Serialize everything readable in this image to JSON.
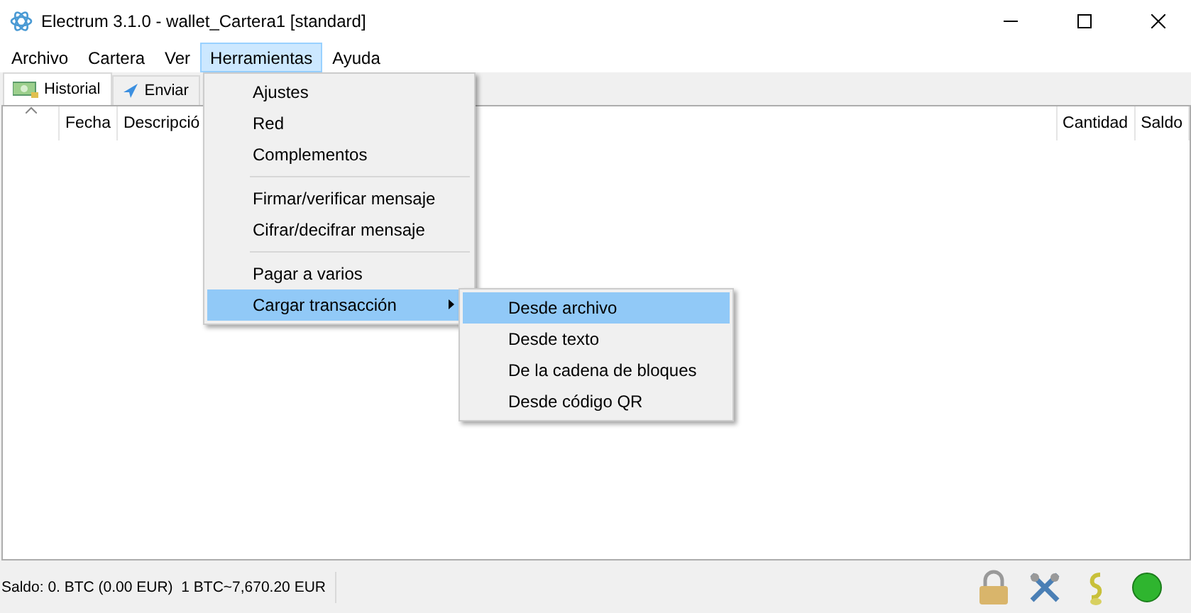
{
  "window": {
    "title": "Electrum 3.1.0  -  wallet_Cartera1  [standard]"
  },
  "menu_bar": [
    {
      "label": "Archivo",
      "selected": false
    },
    {
      "label": "Cartera",
      "selected": false
    },
    {
      "label": "Ver",
      "selected": false
    },
    {
      "label": "Herramientas",
      "selected": true
    },
    {
      "label": "Ayuda",
      "selected": false
    }
  ],
  "tabs": [
    {
      "label": "Historial",
      "selected": true
    },
    {
      "label": "Enviar",
      "selected": false
    }
  ],
  "table": {
    "columns": [
      "Fecha",
      "Descripció",
      "Cantidad",
      "Saldo"
    ]
  },
  "dropdown": [
    {
      "kind": "item",
      "label": "Ajustes",
      "selected": false
    },
    {
      "kind": "item",
      "label": "Red",
      "selected": false
    },
    {
      "kind": "item",
      "label": "Complementos",
      "selected": false
    },
    {
      "kind": "separator"
    },
    {
      "kind": "item",
      "label": "Firmar/verificar mensaje",
      "selected": false
    },
    {
      "kind": "item",
      "label": "Cifrar/decifrar mensaje",
      "selected": false
    },
    {
      "kind": "separator"
    },
    {
      "kind": "item",
      "label": "Pagar a varios",
      "selected": false
    },
    {
      "kind": "submenu",
      "label": "Cargar transacción",
      "selected": true
    }
  ],
  "submenu": [
    {
      "label": "Desde archivo",
      "selected": true
    },
    {
      "label": "Desde texto",
      "selected": false
    },
    {
      "label": "De la cadena de bloques",
      "selected": false
    },
    {
      "label": "Desde código QR",
      "selected": false
    }
  ],
  "status_bar": {
    "balance": "Saldo: 0. BTC (0.00 EUR)",
    "rate": "1 BTC~7,670.20 EUR"
  }
}
